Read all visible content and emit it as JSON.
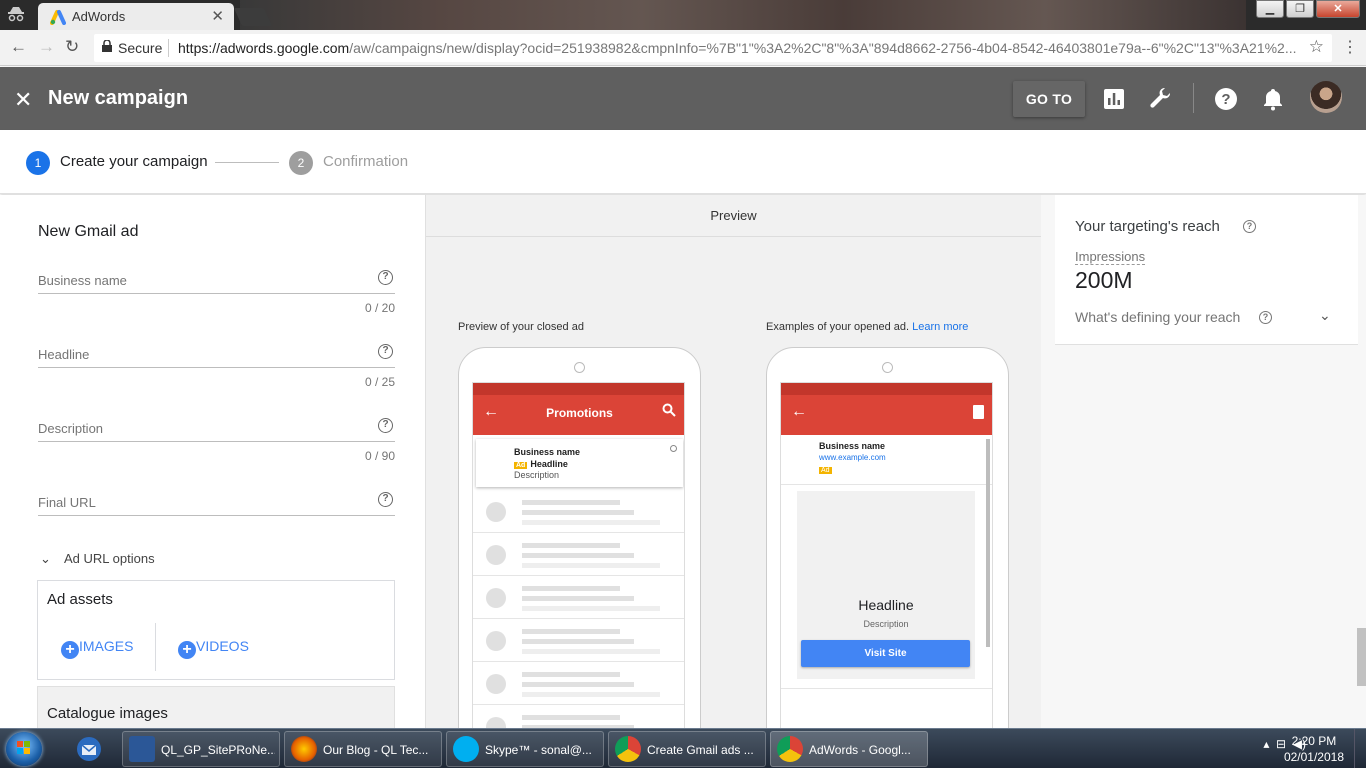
{
  "browser": {
    "tab_title": "AdWords",
    "secure_label": "Secure",
    "url_domain": "https://adwords.google.com",
    "url_path": "/aw/campaigns/new/display?ocid=251938982&cmpnInfo=%7B\"1\"%3A2%2C\"8\"%3A\"894d8662-2756-4b04-8542-46403801e79a--6\"%2C\"13\"%3A21%2..."
  },
  "header": {
    "title": "New campaign",
    "goto_label": "GO TO"
  },
  "stepper": {
    "steps": [
      {
        "num": "1",
        "label": "Create your campaign"
      },
      {
        "num": "2",
        "label": "Confirmation"
      }
    ]
  },
  "form": {
    "title": "New Gmail ad",
    "fields": [
      {
        "label": "Business name",
        "count": "0 / 20"
      },
      {
        "label": "Headline",
        "count": "0 / 25"
      },
      {
        "label": "Description",
        "count": "0 / 90"
      },
      {
        "label": "Final URL",
        "count": ""
      }
    ],
    "url_options": "Ad URL options",
    "assets_title": "Ad assets",
    "images_label": "IMAGES",
    "videos_label": "VIDEOS",
    "catalogue_title": "Catalogue images"
  },
  "preview": {
    "header": "Preview",
    "closed_caption": "Preview of your closed ad",
    "opened_caption": "Examples of your opened ad.",
    "learn_more": "Learn more",
    "promotions": "Promotions",
    "business_name": "Business name",
    "ad_badge": "Ad",
    "headline": "Headline",
    "description": "Description",
    "example_url": "www.example.com",
    "visit_site": "Visit Site"
  },
  "reach": {
    "title": "Your targeting's reach",
    "impressions_label": "Impressions",
    "impressions_value": "200M",
    "defining": "What's defining your reach"
  },
  "taskbar": {
    "items": [
      {
        "label": "QL_GP_SitePRoNe..."
      },
      {
        "label": "Our Blog - QL Tec..."
      },
      {
        "label": "Skype™ - sonal@..."
      },
      {
        "label": "Create Gmail ads ..."
      },
      {
        "label": "AdWords - Googl..."
      }
    ],
    "time": "2:20 PM",
    "date": "02/01/2018"
  },
  "colors": {
    "header_bg": "#5f5f5f",
    "accent_blue": "#4285f4",
    "gmail_red": "#db4437"
  }
}
